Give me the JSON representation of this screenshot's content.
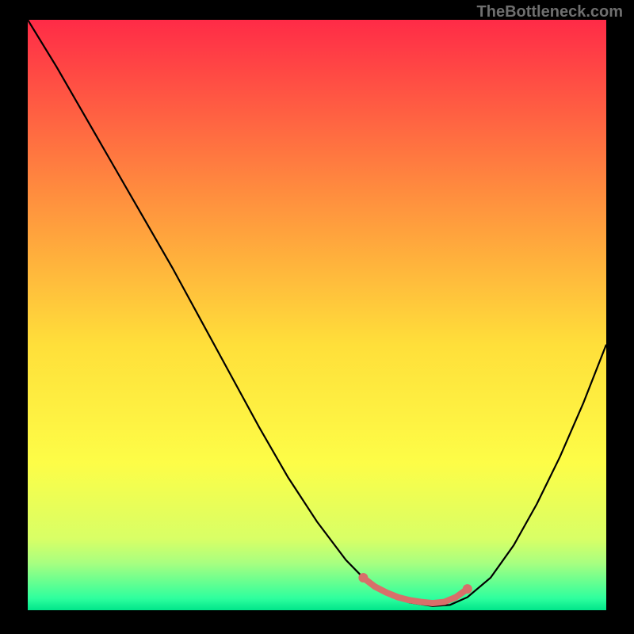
{
  "watermark": "TheBottleneck.com",
  "chart_data": {
    "type": "line",
    "title": "",
    "xlabel": "",
    "ylabel": "",
    "xlim": [
      0,
      100
    ],
    "ylim": [
      0,
      100
    ],
    "background_gradient": {
      "stops": [
        {
          "offset": 0,
          "color": "#ff2b47"
        },
        {
          "offset": 30,
          "color": "#ff8f3e"
        },
        {
          "offset": 55,
          "color": "#ffdf3a"
        },
        {
          "offset": 75,
          "color": "#fdfd47"
        },
        {
          "offset": 88,
          "color": "#d8ff66"
        },
        {
          "offset": 92,
          "color": "#a8ff80"
        },
        {
          "offset": 95,
          "color": "#6bff8f"
        },
        {
          "offset": 98,
          "color": "#2eff9e"
        },
        {
          "offset": 100,
          "color": "#00e58a"
        }
      ]
    },
    "series": [
      {
        "name": "bottleneck-curve",
        "color": "#000000",
        "x": [
          0,
          5,
          10,
          15,
          20,
          25,
          30,
          35,
          40,
          45,
          50,
          55,
          58,
          60,
          63,
          66,
          70,
          73,
          76,
          80,
          84,
          88,
          92,
          96,
          100
        ],
        "values": [
          100,
          92,
          83.5,
          75,
          66.5,
          58,
          49,
          40,
          31,
          22.5,
          15,
          8.5,
          5.5,
          3.8,
          2.2,
          1.3,
          0.7,
          0.9,
          2.2,
          5.5,
          11,
          18,
          26,
          35,
          45
        ]
      }
    ],
    "highlight_segment": {
      "color": "#d86f6a",
      "points_x": [
        58,
        60,
        62,
        64,
        66,
        68,
        70,
        72,
        74,
        76
      ],
      "points_y": [
        5.5,
        4.0,
        3.0,
        2.2,
        1.7,
        1.4,
        1.2,
        1.4,
        2.2,
        3.6
      ],
      "end_dots": [
        {
          "x": 58,
          "y": 5.5
        },
        {
          "x": 76,
          "y": 3.6
        }
      ]
    }
  }
}
